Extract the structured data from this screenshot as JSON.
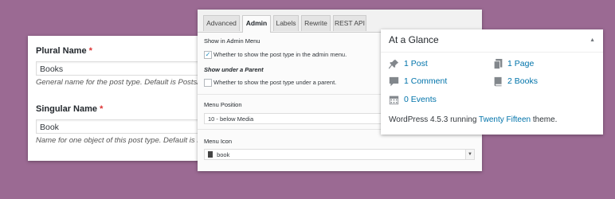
{
  "names": {
    "plural_label": "Plural Name",
    "plural_required": "*",
    "plural_value": "Books",
    "plural_hint": "General name for the post type. Default is Posts/Pages",
    "singular_label": "Singular Name",
    "singular_required": "*",
    "singular_value": "Book",
    "singular_hint": "Name for one object of this post type. Default is Post/Pa"
  },
  "tabs": {
    "items": [
      "Advanced",
      "Admin",
      "Labels",
      "Rewrite",
      "REST API"
    ],
    "active": "Admin"
  },
  "admin": {
    "show_in_menu_title": "Show in Admin Menu",
    "show_in_menu_desc": "Whether to show the post type in the admin menu.",
    "show_in_menu_checked": true,
    "show_under_parent_title": "Show under a Parent",
    "show_under_parent_desc": "Whether to show the post type under a parent.",
    "show_under_parent_checked": false,
    "menu_position_label": "Menu Position",
    "menu_position_value": "10 - below Media",
    "menu_icon_label": "Menu Icon",
    "menu_icon_value": "book"
  },
  "glance": {
    "title": "At a Glance",
    "items": {
      "posts": "1 Post",
      "pages": "1 Page",
      "comments": "1 Comment",
      "books": "2 Books",
      "events": "0 Events"
    },
    "footer_prefix": "WordPress 4.5.3 running",
    "theme_name": "Twenty Fifteen",
    "footer_suffix": "theme."
  },
  "colors": {
    "background": "#9b6a93",
    "link": "#0073aa",
    "required": "#dc3232"
  }
}
